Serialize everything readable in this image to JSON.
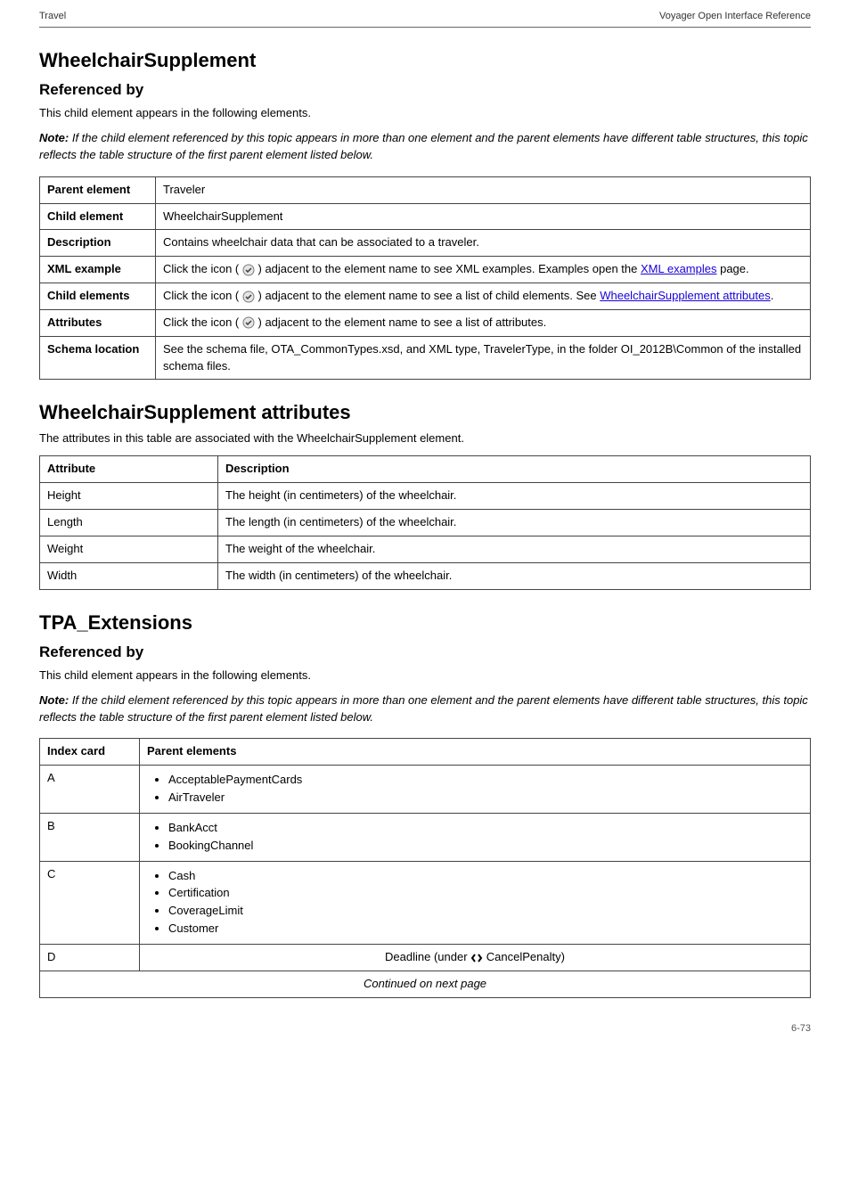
{
  "header": {
    "left": "Travel",
    "right": "Voyager Open Interface Reference"
  },
  "section1": {
    "title": "WheelchairSupplement",
    "subtitle": "Referenced by",
    "intro": "This child element appears in the following elements.",
    "note_label": "Note:",
    "note_body": " If the child element referenced by this topic appears in more than one element and the parent elements have different table structures, this topic reflects the table structure of the first parent element listed below.",
    "table": {
      "r1c1": "Parent element",
      "r1c2": "Traveler",
      "r2c1": "Child element",
      "r2c2": "WheelchairSupplement",
      "r3c1": "Description",
      "r3c2": "Contains wheelchair data that can be associated to a traveler.",
      "r4c1": "XML example",
      "r4c2a": "Click the icon ( ",
      "r4c2b": " ) adjacent to the element name to see XML examples. Examples open the ",
      "r4link1": "XML examples",
      "r4c2c": " page.",
      "r5c1": "Child elements",
      "r5c2a": "Click the icon ( ",
      "r5c2b": " ) adjacent to the element name to see a list of child elements. See ",
      "r5link": "WheelchairSupplement attributes",
      "r5c2c": ".",
      "r6c1": "Attributes",
      "r6c2a": "Click the icon ( ",
      "r6c2b": " ) adjacent to the element name to see a list of attributes.",
      "r7c1": "Schema location",
      "r7c2": "See the schema file, OTA_CommonTypes.xsd, and XML type, TravelerType, in the folder OI_2012B\\Common of the installed schema files."
    }
  },
  "section2": {
    "title": "WheelchairSupplement attributes",
    "intro": "The attributes in this table are associated with the WheelchairSupplement element.",
    "table": {
      "h1": "Attribute",
      "h2": "Description",
      "r1c1": "Height",
      "r1c2": "The height (in centimeters) of the wheelchair.",
      "r2c1": "Length",
      "r2c2": "The length (in centimeters) of the wheelchair.",
      "r3c1": "Weight",
      "r3c2": "The weight of the wheelchair.",
      "r4c1": "Width",
      "r4c2": "The width (in centimeters) of the wheelchair."
    }
  },
  "section3": {
    "title": "TPA_Extensions",
    "subtitle": "Referenced by",
    "intro": "This child element appears in the following elements.",
    "note_label": "Note:",
    "note_body": " If the child element referenced by this topic appears in more than one element and the parent elements have different table structures, this topic reflects the table structure of the first parent element listed below.",
    "table": {
      "h1": "Index card",
      "h2": "Parent elements",
      "r1c1": "A",
      "r1li1": "AcceptablePaymentCards",
      "r1li2": "AirTraveler",
      "r2c1": "B",
      "r2li1": "BankAcct",
      "r2li2": "BookingChannel",
      "r3c1": "C",
      "r3li1": "Cash",
      "r3li2": "Certification",
      "r3li3": "CoverageLimit",
      "r3li4": "Customer",
      "r4c1": "D",
      "r4li": "Deadline (under ",
      "r4li_link": "CancelPenalty",
      "r4li_after": ")",
      "footer": "Continued on next page"
    }
  },
  "footer_page": "6-73"
}
